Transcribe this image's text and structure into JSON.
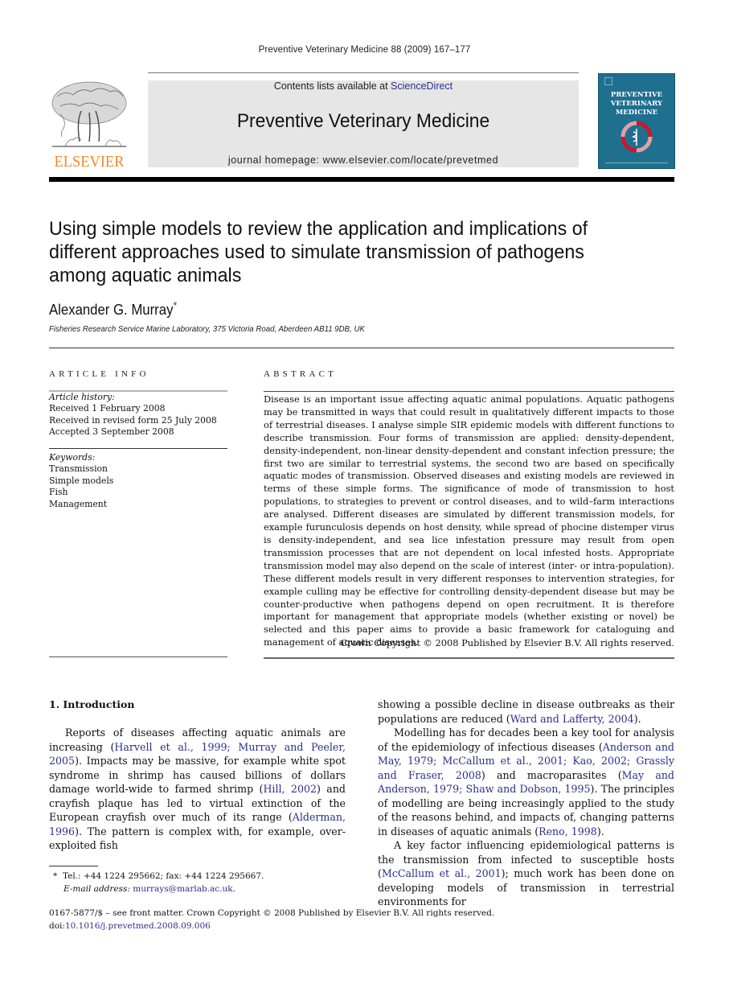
{
  "header": {
    "running_head": "Preventive Veterinary Medicine 88 (2009) 167–177",
    "contents_prefix": "Contents lists available at ",
    "contents_link": "ScienceDirect",
    "journal_title": "Preventive Veterinary Medicine",
    "homepage": "journal homepage: www.elsevier.com/locate/prevetmed",
    "publisher_logo_text": "ELSEVIER",
    "cover": {
      "title_line1": "PREVENTIVE",
      "title_line2": "VETERINARY",
      "title_line3": "MEDICINE",
      "background_color": "#1f6f8f"
    }
  },
  "article": {
    "title": "Using simple models to review the application and implications of different approaches used to simulate transmission of pathogens among aquatic animals",
    "author": "Alexander G. Murray",
    "author_mark": "*",
    "affiliation": "Fisheries Research Service Marine Laboratory, 375 Victoria Road, Aberdeen AB11 9DB, UK"
  },
  "article_info": {
    "heading": "ARTICLE INFO",
    "history_label": "Article history:",
    "history": [
      "Received 1 February 2008",
      "Received in revised form 25 July 2008",
      "Accepted 3 September 2008"
    ],
    "keywords_label": "Keywords:",
    "keywords": [
      "Transmission",
      "Simple models",
      "Fish",
      "Management"
    ]
  },
  "abstract": {
    "heading": "ABSTRACT",
    "text": "Disease is an important issue affecting aquatic animal populations. Aquatic pathogens may be transmitted in ways that could result in qualitatively different impacts to those of terrestrial diseases. I analyse simple SIR epidemic models with different functions to describe transmission. Four forms of transmission are applied: density-dependent, density-independent, non-linear density-dependent and constant infection pressure; the first two are similar to terrestrial systems, the second two are based on specifically aquatic modes of transmission. Observed diseases and existing models are reviewed in terms of these simple forms. The significance of mode of transmission to host populations, to strategies to prevent or control diseases, and to wild–farm interactions are analysed. Different diseases are simulated by different transmission models, for example furunculosis depends on host density, while spread of phocine distemper virus is density-independent, and sea lice infestation pressure may result from open transmission processes that are not dependent on local infested hosts. Appropriate transmission model may also depend on the scale of interest (inter- or intra-population). These different models result in very different responses to intervention strategies, for example culling may be effective for controlling density-dependent disease but may be counter-productive when pathogens depend on open recruitment. It is therefore important for management that appropriate models (whether existing or novel) be selected and this paper aims to provide a basic framework for cataloguing and management of aquatic diseases.",
    "copyright": "Crown Copyright © 2008 Published by Elsevier B.V. All rights reserved."
  },
  "introduction": {
    "heading": "1.  Introduction",
    "left_p1": [
      {
        "t": "Reports of diseases affecting aquatic animals are increasing ("
      },
      {
        "t": "Harvell et al., 1999; Murray and Peeler, 2005",
        "link": true
      },
      {
        "t": "). Impacts may be massive, for example white spot syndrome in shrimp has caused billions of dollars damage world-wide to farmed shrimp ("
      },
      {
        "t": "Hill, 2002",
        "link": true
      },
      {
        "t": ") and crayfish plaque has led to virtual extinction of the European crayfish over much of its range ("
      },
      {
        "t": "Alderman, 1996",
        "link": true
      },
      {
        "t": "). The pattern is complex with, for example, over-exploited fish"
      }
    ],
    "right_p1": [
      {
        "t": "showing a possible decline in disease outbreaks as their populations are reduced ("
      },
      {
        "t": "Ward and Lafferty, 2004",
        "link": true
      },
      {
        "t": ")."
      }
    ],
    "right_p2": [
      {
        "t": "Modelling has for decades been a key tool for analysis of the epidemiology of infectious diseases ("
      },
      {
        "t": "Anderson and May, 1979; McCallum et al., 2001; Kao, 2002; Grassly and Fraser, 2008",
        "link": true
      },
      {
        "t": ") and macroparasites ("
      },
      {
        "t": "May and Anderson, 1979; Shaw and Dobson, 1995",
        "link": true
      },
      {
        "t": "). The principles of modelling are being increasingly applied to the study of the reasons behind, and impacts of, changing patterns in diseases of aquatic animals ("
      },
      {
        "t": "Reno, 1998",
        "link": true
      },
      {
        "t": ")."
      }
    ],
    "right_p3": [
      {
        "t": "A key factor influencing epidemiological patterns is the transmission from infected to susceptible hosts ("
      },
      {
        "t": "McCallum et al., 2001",
        "link": true
      },
      {
        "t": "); much work has been done on developing models of transmission in terrestrial environments for"
      }
    ]
  },
  "footnote": {
    "mark": "*",
    "contact": "Tel.: +44 1224 295662; fax: +44 1224 295667.",
    "email_label": "E-mail address:",
    "email": "murrays@marlab.ac.uk",
    "email_suffix": "."
  },
  "front_matter": {
    "issn_line": "0167-5877/$ – see front matter. Crown Copyright © 2008 Published by Elsevier B.V. All rights reserved.",
    "doi_prefix": "doi:",
    "doi": "10.1016/j.prevetmed.2008.09.006"
  },
  "colors": {
    "link": "#2b2f8c",
    "elsevier_orange": "#f08a24",
    "banner_grey": "#e6e6e6"
  }
}
